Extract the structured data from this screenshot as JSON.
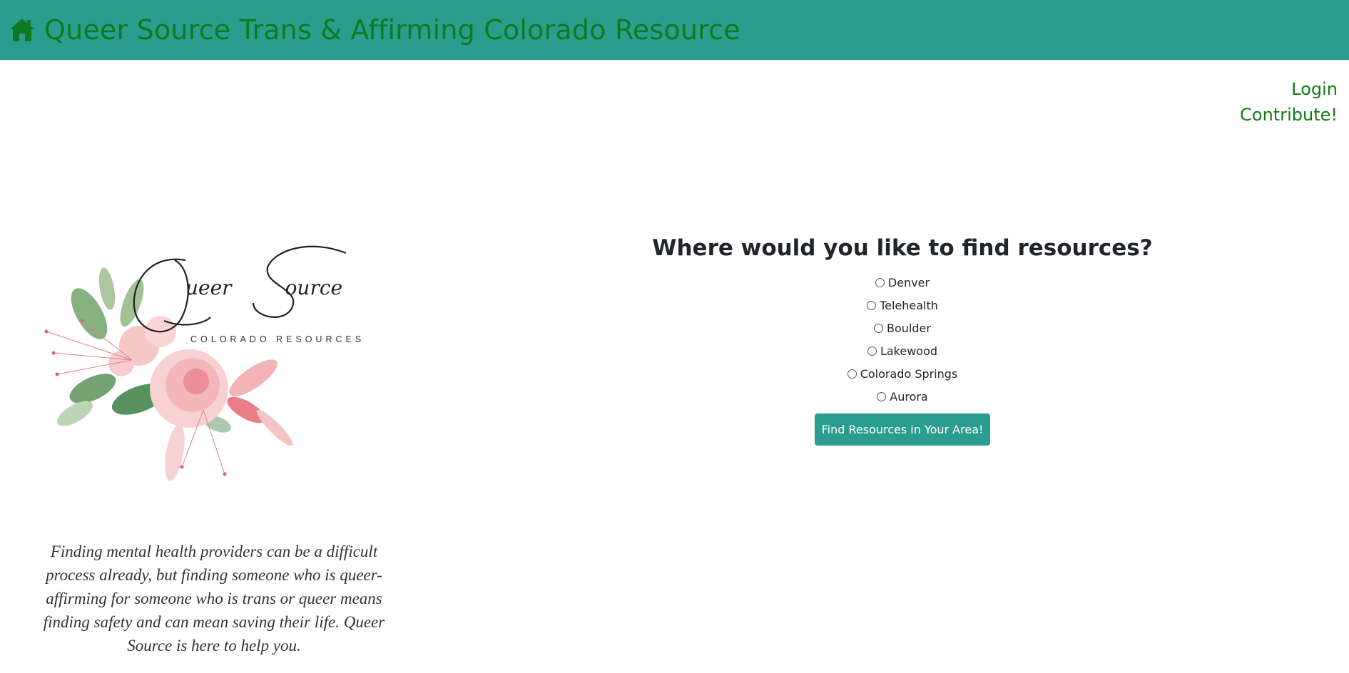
{
  "header": {
    "icon": "home-icon",
    "title": "Queer Source Trans & Affirming Colorado Resource",
    "background": "#2a9d8f",
    "title_color": "#0d7a1f"
  },
  "auth": {
    "login": "Login",
    "contribute": "Contribute!"
  },
  "logo": {
    "title": "Queer Source",
    "subtitle": "COLORADO RESOURCES"
  },
  "mission": {
    "text": "Finding mental health providers can be a difficult process already, but finding someone who is queer-affirming for someone who is trans or queer means finding safety and can mean saving their life. Queer Source is here to help you."
  },
  "finder": {
    "heading": "Where would you like to find resources?",
    "options": [
      "Denver",
      "Telehealth",
      "Boulder",
      "Lakewood",
      "Colorado Springs",
      "Aurora"
    ],
    "button": "Find Resources in Your Area!"
  }
}
